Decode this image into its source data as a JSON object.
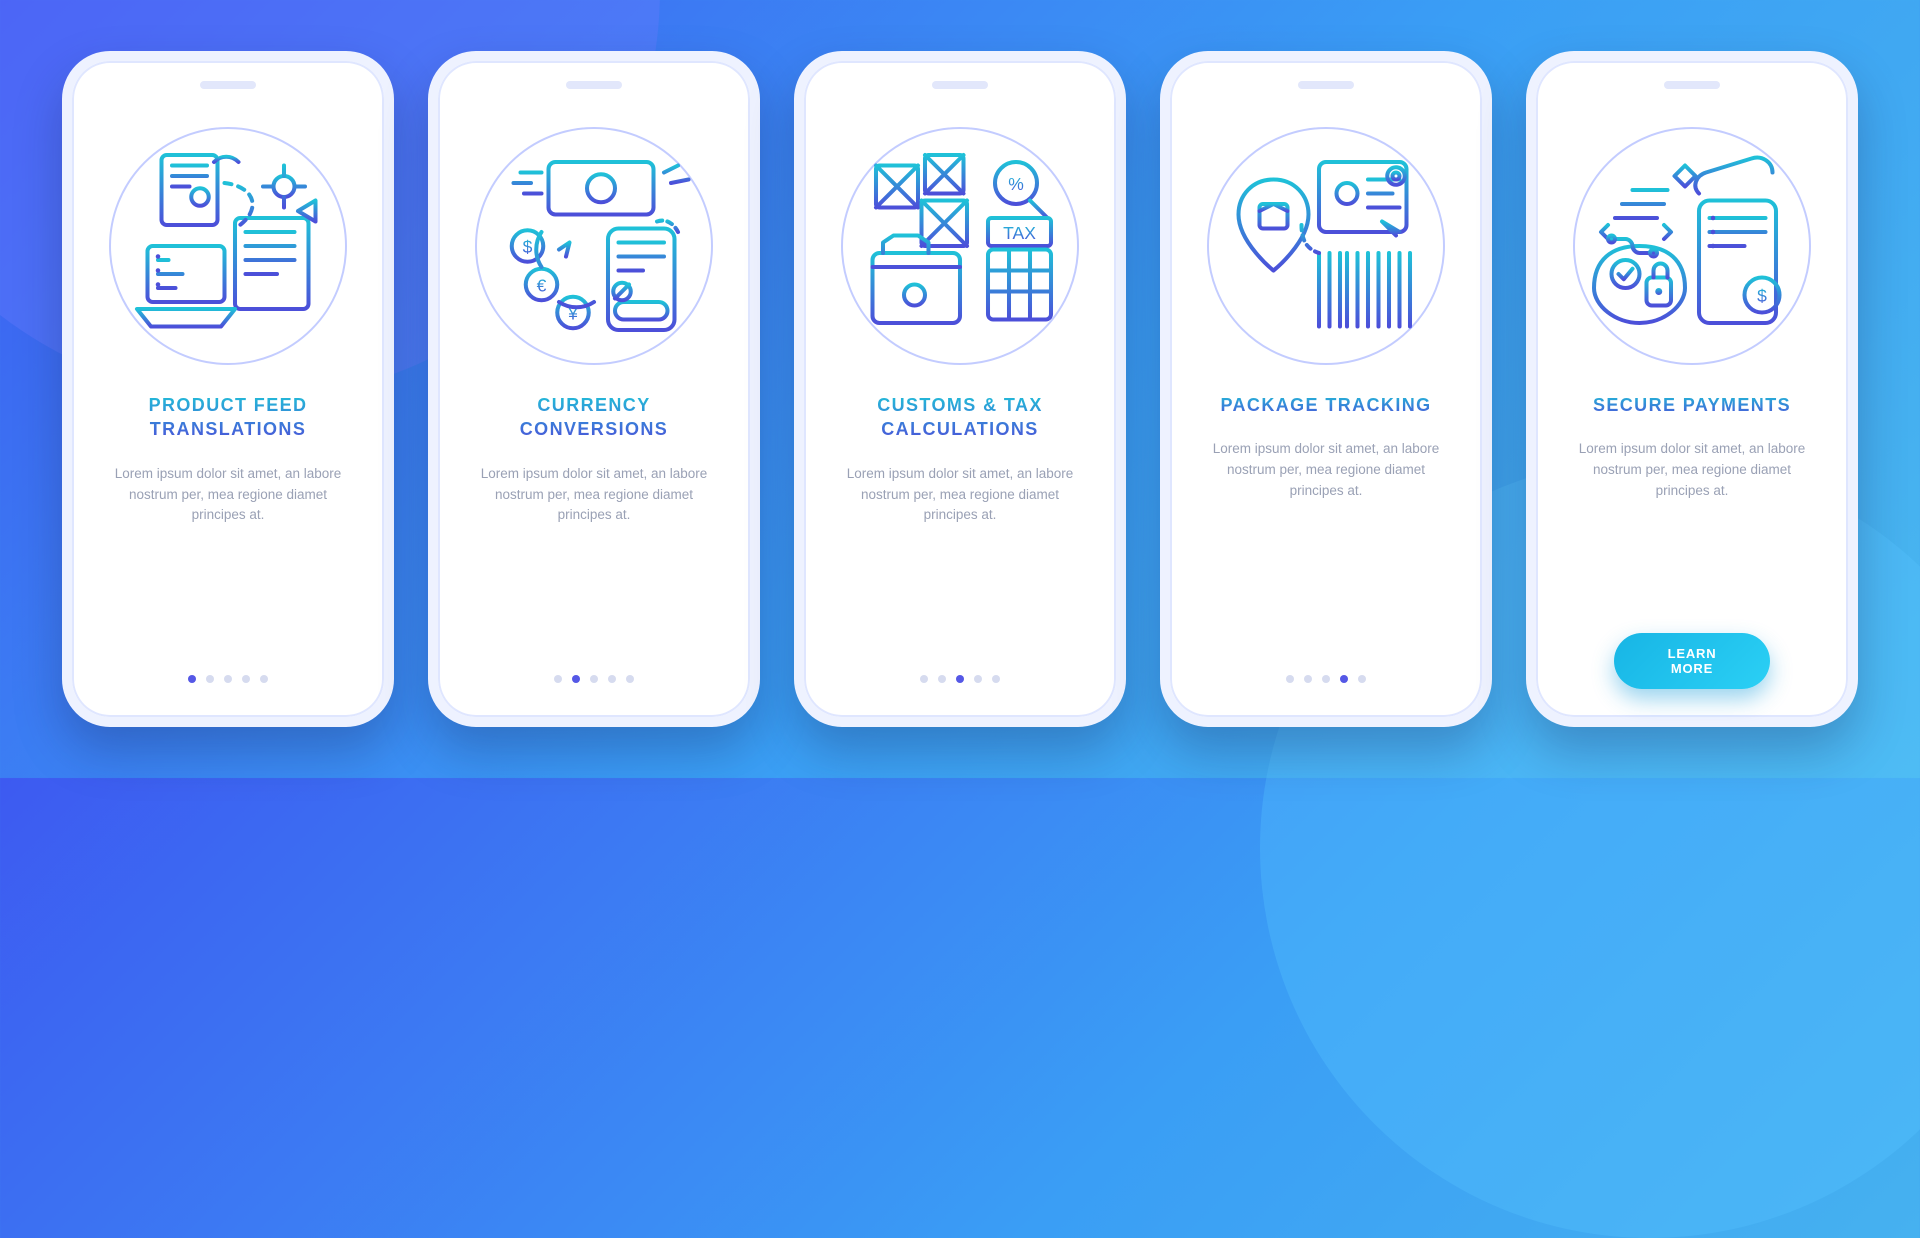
{
  "colors": {
    "bg_gradient_start": "#3d5af1",
    "bg_gradient_mid": "#3a9ef5",
    "bg_gradient_end": "#4ab8ee",
    "icon_gradient_top": "#1fc1d8",
    "icon_gradient_bottom": "#4c4fd9",
    "cta_gradient_start": "#17b5e5",
    "cta_gradient_end": "#2bd0f5",
    "text_muted": "#9aa1b5",
    "dot_inactive": "#d6dbef",
    "dot_active": "#5558e6"
  },
  "screens": [
    {
      "icon": "product-feed-translations-icon",
      "title": "PRODUCT FEED TRANSLATIONS",
      "description": "Lorem ipsum dolor sit amet, an labore nostrum per, mea regione diamet principes at.",
      "active_dot": 0
    },
    {
      "icon": "currency-conversions-icon",
      "title": "CURRENCY CONVERSIONS",
      "description": "Lorem ipsum dolor sit amet, an labore nostrum per, mea regione diamet principes at.",
      "active_dot": 1
    },
    {
      "icon": "customs-tax-calculations-icon",
      "title": "CUSTOMS & TAX CALCULATIONS",
      "description": "Lorem ipsum dolor sit amet, an labore nostrum per, mea regione diamet principes at.",
      "active_dot": 2
    },
    {
      "icon": "package-tracking-icon",
      "title": "PACKAGE TRACKING",
      "description": "Lorem ipsum dolor sit amet, an labore nostrum per, mea regione diamet principes at.",
      "active_dot": 3
    },
    {
      "icon": "secure-payments-icon",
      "title": "SECURE PAYMENTS",
      "description": "Lorem ipsum dolor sit amet, an labore nostrum per, mea regione diamet principes at.",
      "active_dot": 4,
      "cta_label": "LEARN MORE"
    }
  ],
  "total_dots": 5
}
